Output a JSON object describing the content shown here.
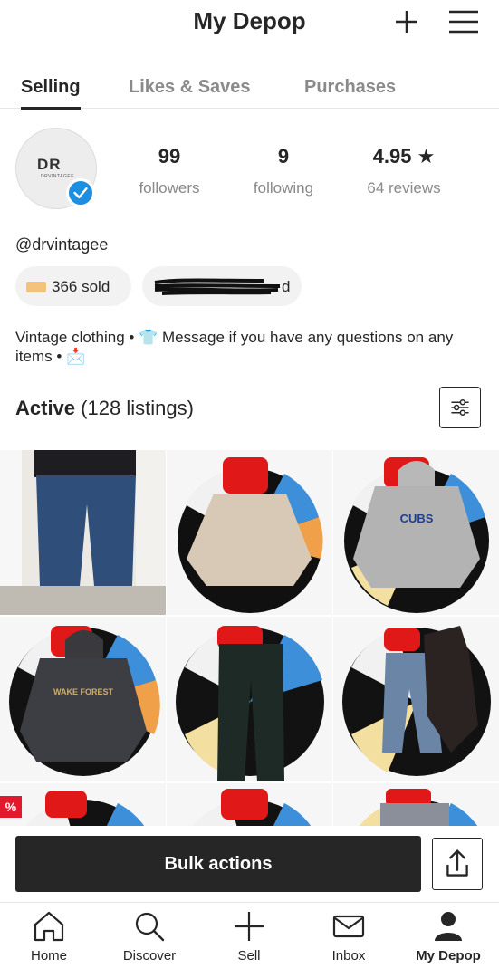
{
  "header": {
    "title": "My Depop"
  },
  "tabs": [
    {
      "label": "Selling",
      "active": true
    },
    {
      "label": "Likes & Saves",
      "active": false
    },
    {
      "label": "Purchases",
      "active": false
    }
  ],
  "profile": {
    "avatar_text": "DR",
    "avatar_subtext": "DRVINTAGEE",
    "username": "@drvintagee",
    "stats": [
      {
        "value": "99",
        "label": "followers"
      },
      {
        "value": "9",
        "label": "following"
      },
      {
        "value": "4.95 ★",
        "label": "64 reviews"
      }
    ],
    "sold_pill": "366 sold",
    "redacted_pill_tail": "d",
    "bio": "Vintage clothing • 👕 Message if you have any questions on any items • 📩"
  },
  "listings": {
    "heading_bold": "Active",
    "heading_count": "(128 listings)",
    "sale_badge": "%",
    "items": [
      {
        "icon": "jeans-photo"
      },
      {
        "icon": "jacket-photo"
      },
      {
        "icon": "cubs-hoodie-photo",
        "print": "CUBS"
      },
      {
        "icon": "wake-forest-hoodie-photo",
        "print": "WAKE FOREST"
      },
      {
        "icon": "black-pants-photo"
      },
      {
        "icon": "hoodie-and-jeans-photo"
      },
      {
        "icon": "rug-photo"
      },
      {
        "icon": "rug-photo"
      },
      {
        "icon": "jeans-on-rug-photo"
      }
    ]
  },
  "actions": {
    "bulk_label": "Bulk actions"
  },
  "nav": [
    {
      "label": "Home",
      "icon": "home-icon"
    },
    {
      "label": "Discover",
      "icon": "search-icon"
    },
    {
      "label": "Sell",
      "icon": "plus-icon"
    },
    {
      "label": "Inbox",
      "icon": "envelope-icon"
    },
    {
      "label": "My Depop",
      "icon": "person-icon",
      "active": true
    }
  ],
  "colors": {
    "accent_dark": "#262626",
    "verified_blue": "#1e8fe0",
    "sale_red": "#e0192c"
  }
}
